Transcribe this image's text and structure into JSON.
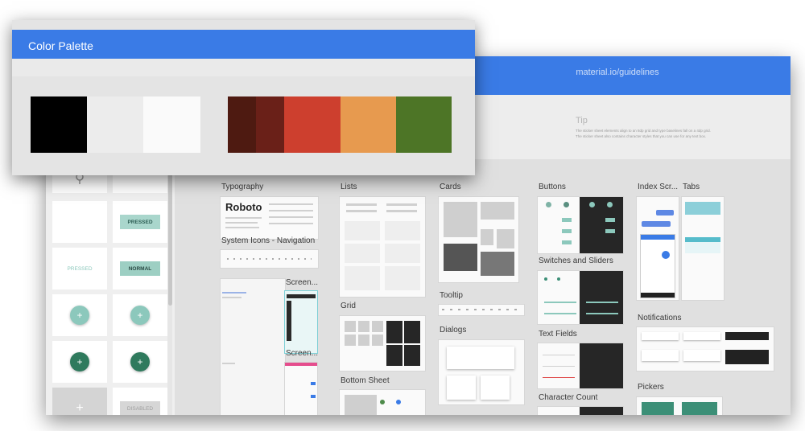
{
  "front_window": {
    "title": "Color Palette",
    "swatches_group_1": [
      "#000000",
      "#ececec",
      "#fafafa"
    ],
    "swatches_group_2": [
      "#4e1a11",
      "#6a2018",
      "#cd3f2e",
      "#e79a4f",
      "#4d7526"
    ]
  },
  "back_window": {
    "url": "material.io/guidelines",
    "tip": {
      "title": "Tip",
      "line1": "The sticker sheet elements align to an 8dp grid and type baselines fall on a 4dp grid.",
      "line2": "The sticker sheet also contains character styles that you can use for any text box."
    },
    "left_panel": {
      "chips": [
        "PRESSED",
        "PRESSED",
        "NORMAL",
        "DISABLED"
      ],
      "fab_plus": "+"
    },
    "sections": {
      "typography": "Typography",
      "typography_sample": "Roboto",
      "system_icons": "System Icons - Navigation",
      "screen_1": "Screen...",
      "screen_2": "Screen...",
      "lists": "Lists",
      "grid": "Grid",
      "bottom_sheet": "Bottom Sheet",
      "cards": "Cards",
      "tooltip": "Tooltip",
      "dialogs": "Dialogs",
      "buttons": "Buttons",
      "switches_sliders": "Switches and Sliders",
      "text_fields": "Text Fields",
      "character_count": "Character Count",
      "index_scroll": "Index Scr...",
      "tabs": "Tabs",
      "notifications": "Notifications",
      "pickers": "Pickers"
    }
  },
  "colors": {
    "accent_blue": "#3a7be6",
    "teal_light": "#8cc8bc",
    "teal_dark": "#2f7a5d"
  }
}
